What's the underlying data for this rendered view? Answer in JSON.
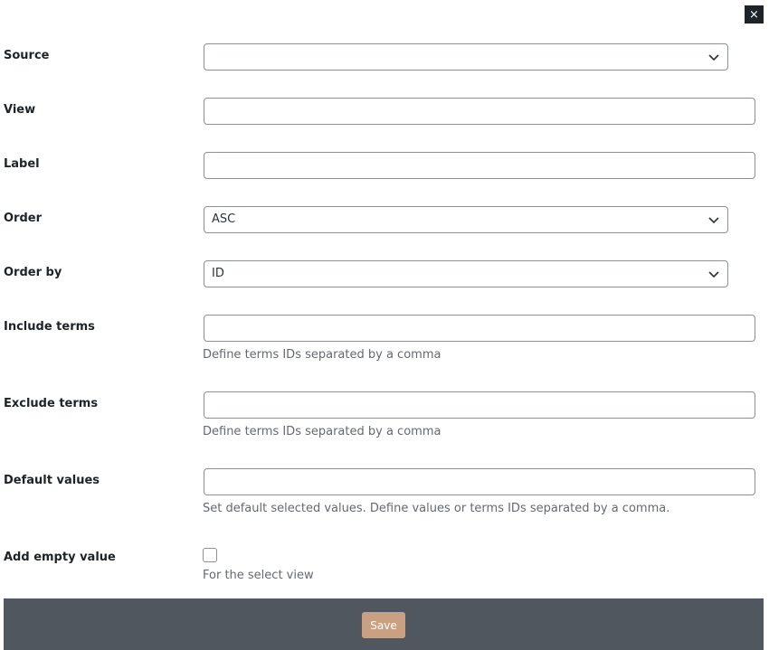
{
  "modal": {
    "close_label": "×"
  },
  "form": {
    "source": {
      "label": "Source",
      "value": ""
    },
    "view": {
      "label": "View",
      "value": ""
    },
    "label_field": {
      "label": "Label",
      "value": ""
    },
    "order": {
      "label": "Order",
      "value": "ASC"
    },
    "order_by": {
      "label": "Order by",
      "value": "ID"
    },
    "include_terms": {
      "label": "Include terms",
      "value": "",
      "description": "Define terms IDs separated by a comma"
    },
    "exclude_terms": {
      "label": "Exclude terms",
      "value": "",
      "description": "Define terms IDs separated by a comma"
    },
    "default_values": {
      "label": "Default values",
      "value": "",
      "description": "Set default selected values. Define values or terms IDs separated by a comma."
    },
    "add_empty_value": {
      "label": "Add empty value",
      "checked": false,
      "description": "For the select view"
    }
  },
  "footer": {
    "save_label": "Save"
  },
  "colors": {
    "footer_bg": "#50575e",
    "save_button_bg": "#c9a182",
    "close_button_bg": "#1d2327"
  },
  "icons": {
    "select": "chevron-down-icon",
    "close": "close-icon"
  }
}
